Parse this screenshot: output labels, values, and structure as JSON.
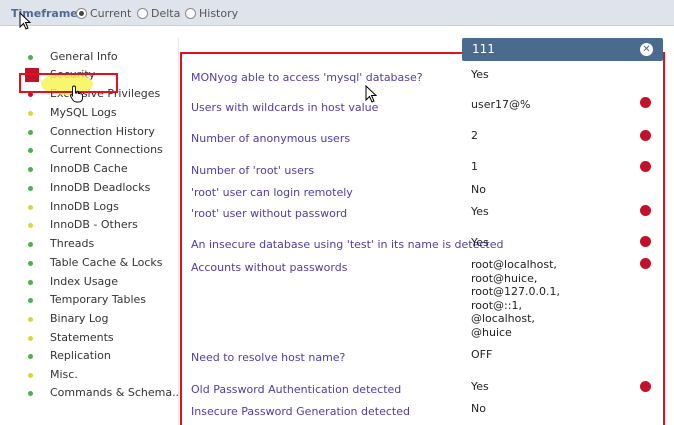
{
  "topbar": {
    "label": "Timeframe",
    "options": [
      {
        "label": "Current",
        "checked": true
      },
      {
        "label": "Delta",
        "checked": false
      },
      {
        "label": "History",
        "checked": false
      }
    ]
  },
  "sidebar": {
    "items": [
      {
        "label": "General Info",
        "dot_color": "#4caf50"
      },
      {
        "label": "Security",
        "dot_color": "#c2112a"
      },
      {
        "label": "Excessive Privileges",
        "dot_color": "#c2112a"
      },
      {
        "label": "MySQL Logs",
        "dot_color": "#d8d83a"
      },
      {
        "label": "Connection History",
        "dot_color": "#4caf50"
      },
      {
        "label": "Current Connections",
        "dot_color": "#4caf50"
      },
      {
        "label": "InnoDB Cache",
        "dot_color": "#4caf50"
      },
      {
        "label": "InnoDB Deadlocks",
        "dot_color": "#4caf50"
      },
      {
        "label": "InnoDB Logs",
        "dot_color": "#d8d83a"
      },
      {
        "label": "InnoDB - Others",
        "dot_color": "#d8d83a"
      },
      {
        "label": "Threads",
        "dot_color": "#4caf50"
      },
      {
        "label": "Table Cache & Locks",
        "dot_color": "#4caf50"
      },
      {
        "label": "Index Usage",
        "dot_color": "#4caf50"
      },
      {
        "label": "Temporary Tables",
        "dot_color": "#4caf50"
      },
      {
        "label": "Binary Log",
        "dot_color": "#d8d83a"
      },
      {
        "label": "Statements",
        "dot_color": "#d8d83a"
      },
      {
        "label": "Replication",
        "dot_color": "#4caf50"
      },
      {
        "label": "Misc.",
        "dot_color": "#d8d83a"
      },
      {
        "label": "Commands & Schema...",
        "dot_color": "#4caf50"
      }
    ]
  },
  "panel": {
    "column_title": "111",
    "close_icon": "close-circle-icon",
    "alert_color": "#c2112a",
    "rows": [
      {
        "label": "MONyog able to access 'mysql' database?",
        "value": "Yes",
        "alert": false
      },
      {
        "label": "Users with wildcards in host value",
        "value": "user17@%",
        "alert": true
      },
      {
        "label": "Number of anonymous users",
        "value": "2",
        "alert": true
      },
      {
        "label": "Number of 'root' users",
        "value": "1",
        "alert": true
      },
      {
        "label": "'root' user can login remotely",
        "value": "No",
        "alert": false
      },
      {
        "label": "'root' user without password",
        "value": "Yes",
        "alert": true
      },
      {
        "label": "An insecure database using 'test' in its name is detected",
        "value": "Yes",
        "alert": true
      },
      {
        "label": "Accounts without passwords",
        "value": "root@localhost,\nroot@huice,\nroot@127.0.0.1,\nroot@::1,\n@localhost,\n@huice",
        "alert": true
      },
      {
        "label": "Need to resolve host name?",
        "value": "OFF",
        "alert": false
      },
      {
        "label": "Old Password Authentication detected",
        "value": "Yes",
        "alert": true
      },
      {
        "label": "Insecure Password Generation detected",
        "value": "No",
        "alert": false
      }
    ]
  }
}
